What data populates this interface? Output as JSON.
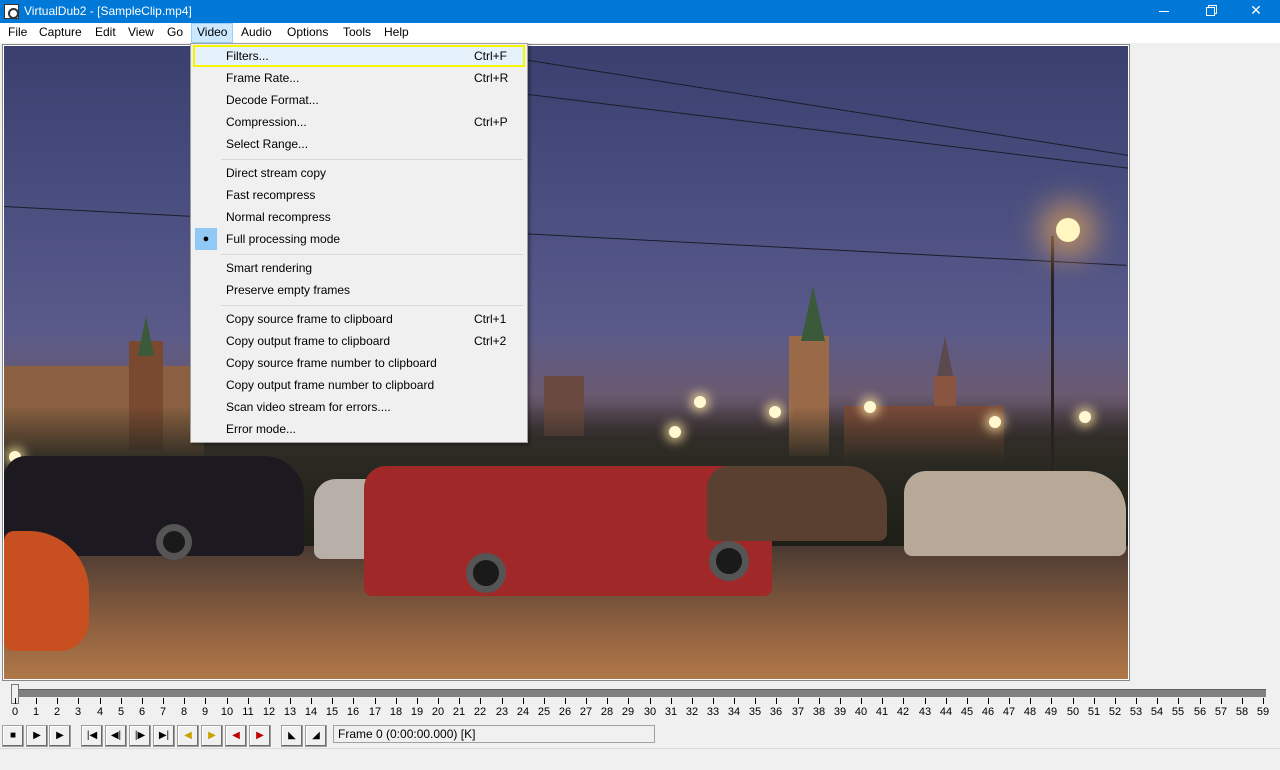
{
  "window": {
    "title": "VirtualDub2 - [SampleClip.mp4]",
    "controls": [
      "minimize",
      "maximize",
      "close"
    ]
  },
  "menubar": {
    "items": [
      {
        "label": "File"
      },
      {
        "label": "Capture"
      },
      {
        "label": "Edit"
      },
      {
        "label": "View"
      },
      {
        "label": "Go"
      },
      {
        "label": "Video",
        "active": true
      },
      {
        "label": "Audio"
      },
      {
        "label": "Options"
      },
      {
        "label": "Tools"
      },
      {
        "label": "Help"
      }
    ]
  },
  "video_menu": {
    "items": [
      {
        "label": "Filters...",
        "shortcut": "Ctrl+F",
        "highlighted": true
      },
      {
        "label": "Frame Rate...",
        "shortcut": "Ctrl+R"
      },
      {
        "label": "Decode Format...",
        "shortcut": ""
      },
      {
        "label": "Compression...",
        "shortcut": "Ctrl+P"
      },
      {
        "label": "Select Range...",
        "shortcut": ""
      },
      {
        "label": "Direct stream copy",
        "shortcut": ""
      },
      {
        "label": "Fast recompress",
        "shortcut": ""
      },
      {
        "label": "Normal recompress",
        "shortcut": ""
      },
      {
        "label": "Full processing mode",
        "shortcut": "",
        "checked": true
      },
      {
        "label": "Smart rendering",
        "shortcut": ""
      },
      {
        "label": "Preserve empty frames",
        "shortcut": ""
      },
      {
        "label": "Copy source frame to clipboard",
        "shortcut": "Ctrl+1"
      },
      {
        "label": "Copy output frame to clipboard",
        "shortcut": "Ctrl+2"
      },
      {
        "label": "Copy source frame number to clipboard",
        "shortcut": ""
      },
      {
        "label": "Copy output frame number to clipboard",
        "shortcut": ""
      },
      {
        "label": "Scan video stream for errors....",
        "shortcut": ""
      },
      {
        "label": "Error mode...",
        "shortcut": ""
      }
    ],
    "checked_mark": "●"
  },
  "timeline": {
    "position_frame": 0,
    "tick_labels": [
      "0",
      "1",
      "2",
      "3",
      "4",
      "5",
      "6",
      "7",
      "8",
      "9",
      "10",
      "11",
      "12",
      "13",
      "14",
      "15",
      "16",
      "17",
      "18",
      "19",
      "20",
      "21",
      "22",
      "23",
      "24",
      "25",
      "26",
      "27",
      "28",
      "29",
      "30",
      "31",
      "32",
      "33",
      "34",
      "35",
      "36",
      "37",
      "38",
      "39",
      "40",
      "41",
      "42",
      "43",
      "44",
      "45",
      "46",
      "47",
      "48",
      "49",
      "50",
      "51",
      "52",
      "53",
      "54",
      "55",
      "56",
      "57",
      "58",
      "59"
    ]
  },
  "toolbar": {
    "buttons": [
      {
        "name": "stop-icon",
        "glyph": "■"
      },
      {
        "name": "play-input-icon",
        "glyph": "▶"
      },
      {
        "name": "play-output-icon",
        "glyph": "▶"
      },
      {
        "name": "start-icon",
        "glyph": "|◀"
      },
      {
        "name": "prev-frame-icon",
        "glyph": "◀|"
      },
      {
        "name": "next-frame-icon",
        "glyph": "|▶"
      },
      {
        "name": "end-icon",
        "glyph": "▶|"
      },
      {
        "name": "prev-keyframe-icon",
        "glyph": "◀"
      },
      {
        "name": "next-keyframe-icon",
        "glyph": "▶"
      },
      {
        "name": "prev-scene-icon",
        "glyph": "◀"
      },
      {
        "name": "next-scene-icon",
        "glyph": "▶"
      },
      {
        "name": "mark-in-icon",
        "glyph": "◣"
      },
      {
        "name": "mark-out-icon",
        "glyph": "◢"
      }
    ],
    "frame_status": "Frame 0 (0:00:00.000) [K]"
  },
  "colors": {
    "titlebar": "#0078d7",
    "menu_active_bg": "#cce8ff",
    "highlight_border": "#f5f500",
    "checked_bg": "#90c8f6"
  }
}
